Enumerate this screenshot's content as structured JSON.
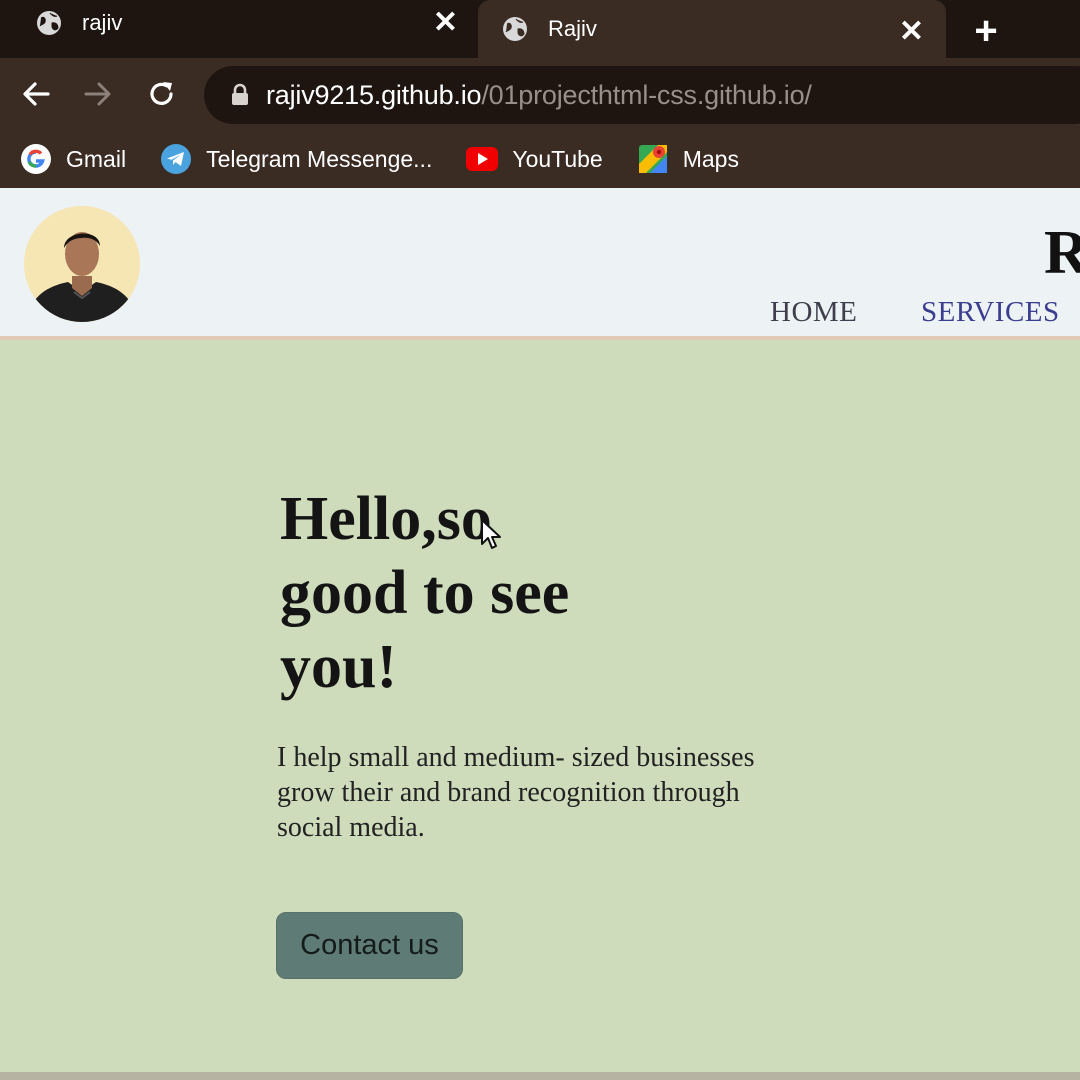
{
  "browser": {
    "tabs": [
      {
        "title": "rajiv",
        "icon": "globe-icon",
        "active": false
      },
      {
        "title": "Rajiv",
        "icon": "globe-icon",
        "active": true
      }
    ],
    "address": {
      "host": "rajiv9215.github.io",
      "path": "/01projecthtml-css.github.io/"
    },
    "bookmarks": [
      {
        "label": "Gmail",
        "icon": "google-icon"
      },
      {
        "label": "Telegram Messenge...",
        "icon": "telegram-icon"
      },
      {
        "label": "YouTube",
        "icon": "youtube-icon"
      },
      {
        "label": "Maps",
        "icon": "maps-icon"
      }
    ]
  },
  "site": {
    "brand_initial": "R",
    "nav": {
      "home": "HOME",
      "services": "SERVICES"
    },
    "hero": {
      "heading_line1": "Hello,so",
      "heading_line2": "good to see",
      "heading_line3": "you!",
      "text_line1": "I help small and medium- sized businesses",
      "text_line2": "grow their and brand recognition through",
      "text_line3": "social media.",
      "cta": "Contact us"
    }
  },
  "colors": {
    "chrome_dark": "#1e1511",
    "chrome": "#3a2b23",
    "header_bg": "#edf2f5",
    "hero_bg": "#cfdcbb",
    "button_bg": "#5e7c75",
    "services_link": "#3b3e8f"
  }
}
